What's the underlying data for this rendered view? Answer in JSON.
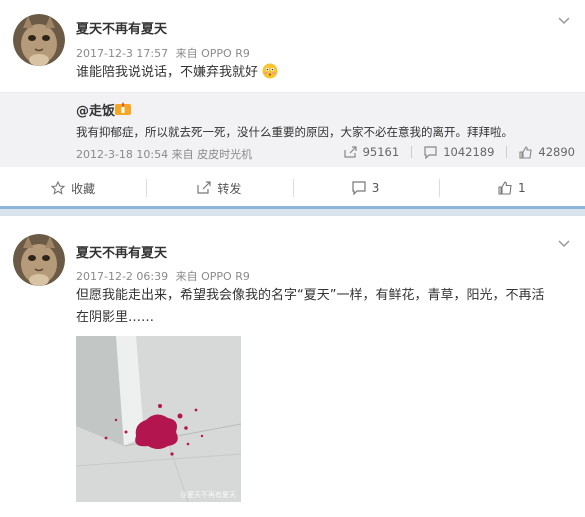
{
  "post1": {
    "username": "夏天不再有夏天",
    "date": "2017-12-3 17:57",
    "source": "来自 OPPO R9",
    "text": "谁能陪我说说话，不嫌弃我就好",
    "emoji": "flushed-face-emoji",
    "quote": {
      "username": "@走饭",
      "text": "我有抑郁症，所以就去死一死，没什么重要的原因，大家不必在意我的离开。拜拜啦。",
      "date": "2012-3-18 10:54",
      "source": "来自 皮皮时光机",
      "reposts": "95161",
      "comments": "1042189",
      "likes": "42890"
    },
    "actions": {
      "favorite": "收藏",
      "repost": "转发",
      "comments": "3",
      "likes": "1"
    }
  },
  "post2": {
    "username": "夏天不再有夏天",
    "date": "2017-12-2 06:39",
    "source": "来自 OPPO R9",
    "text_line1": "但愿我能走出来，希望我会像我的名字“夏天”一样，有鲜花，青草，阳光，不再活",
    "text_line2": "在阴影里……",
    "photo_watermark": "@夏天不再有夏天"
  },
  "colors": {
    "divider": "#8fb6d8",
    "meta_gray": "#8a8a8a",
    "quote_bg": "#f2f2f5"
  }
}
